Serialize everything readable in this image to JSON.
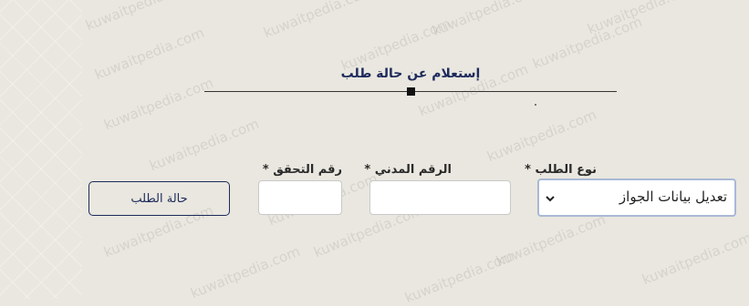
{
  "watermark": "kuwaitpedia.com",
  "form": {
    "title": "إستعلام عن حالة طلب",
    "fields": {
      "request_type": {
        "label": "نوع الطلب",
        "required_mark": "*",
        "selected": "تعديل بيانات الجواز"
      },
      "civil_id": {
        "label": "الرقم المدني",
        "required_mark": "*",
        "value": ""
      },
      "verification_code": {
        "label": "رقم التحقق",
        "required_mark": "*",
        "value": ""
      }
    },
    "submit_label": "حالة الطلب"
  },
  "colors": {
    "accent": "#1d2a5c",
    "background": "#e9e7df",
    "select_focus_border": "#aab8d6"
  },
  "icons": {
    "select_arrow": "chevron-down-icon"
  }
}
